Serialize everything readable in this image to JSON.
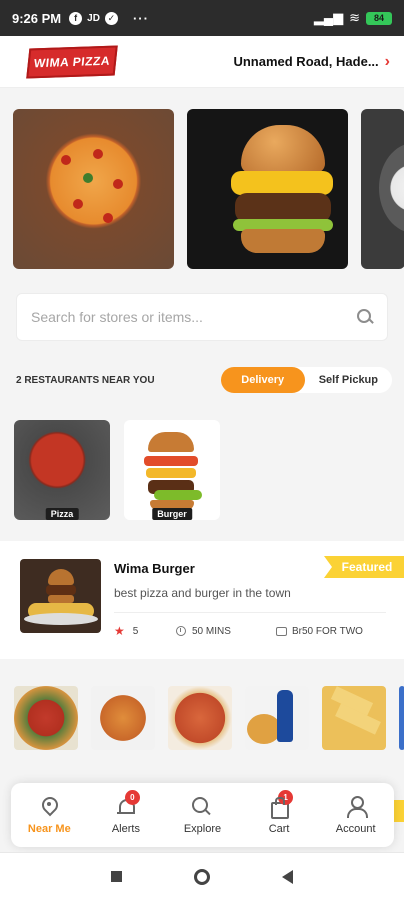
{
  "status_bar": {
    "time": "9:26 PM",
    "icons": [
      "facebook-icon",
      "jd-icon",
      "check-icon",
      "more-dots-icon"
    ],
    "jd_label": "JD",
    "battery": "84"
  },
  "header": {
    "logo_text": "WIMA PIZZA",
    "location": "Unnamed Road, Hade..."
  },
  "search": {
    "placeholder": "Search for stores or items..."
  },
  "filters": {
    "near_text": "2 RESTAURANTS NEAR YOU",
    "options": [
      "Delivery",
      "Self Pickup"
    ],
    "active": "Delivery"
  },
  "categories": [
    {
      "label": "Pizza"
    },
    {
      "label": "Burger"
    }
  ],
  "restaurant": {
    "name": "Wima Burger",
    "description": "best pizza and burger in the town",
    "badge": "Featured",
    "rating": "5",
    "time": "50 MINS",
    "price": "Br50 FOR TWO"
  },
  "bottom_nav": [
    {
      "label": "Near Me",
      "icon": "map-pin-icon",
      "active": true
    },
    {
      "label": "Alerts",
      "icon": "bell-icon",
      "badge": "0"
    },
    {
      "label": "Explore",
      "icon": "search-icon"
    },
    {
      "label": "Cart",
      "icon": "shopping-bag-icon",
      "badge": "1"
    },
    {
      "label": "Account",
      "icon": "person-icon"
    }
  ],
  "colors": {
    "accent": "#f7941d",
    "brand_red": "#d62b2b",
    "featured": "#fbd235"
  }
}
